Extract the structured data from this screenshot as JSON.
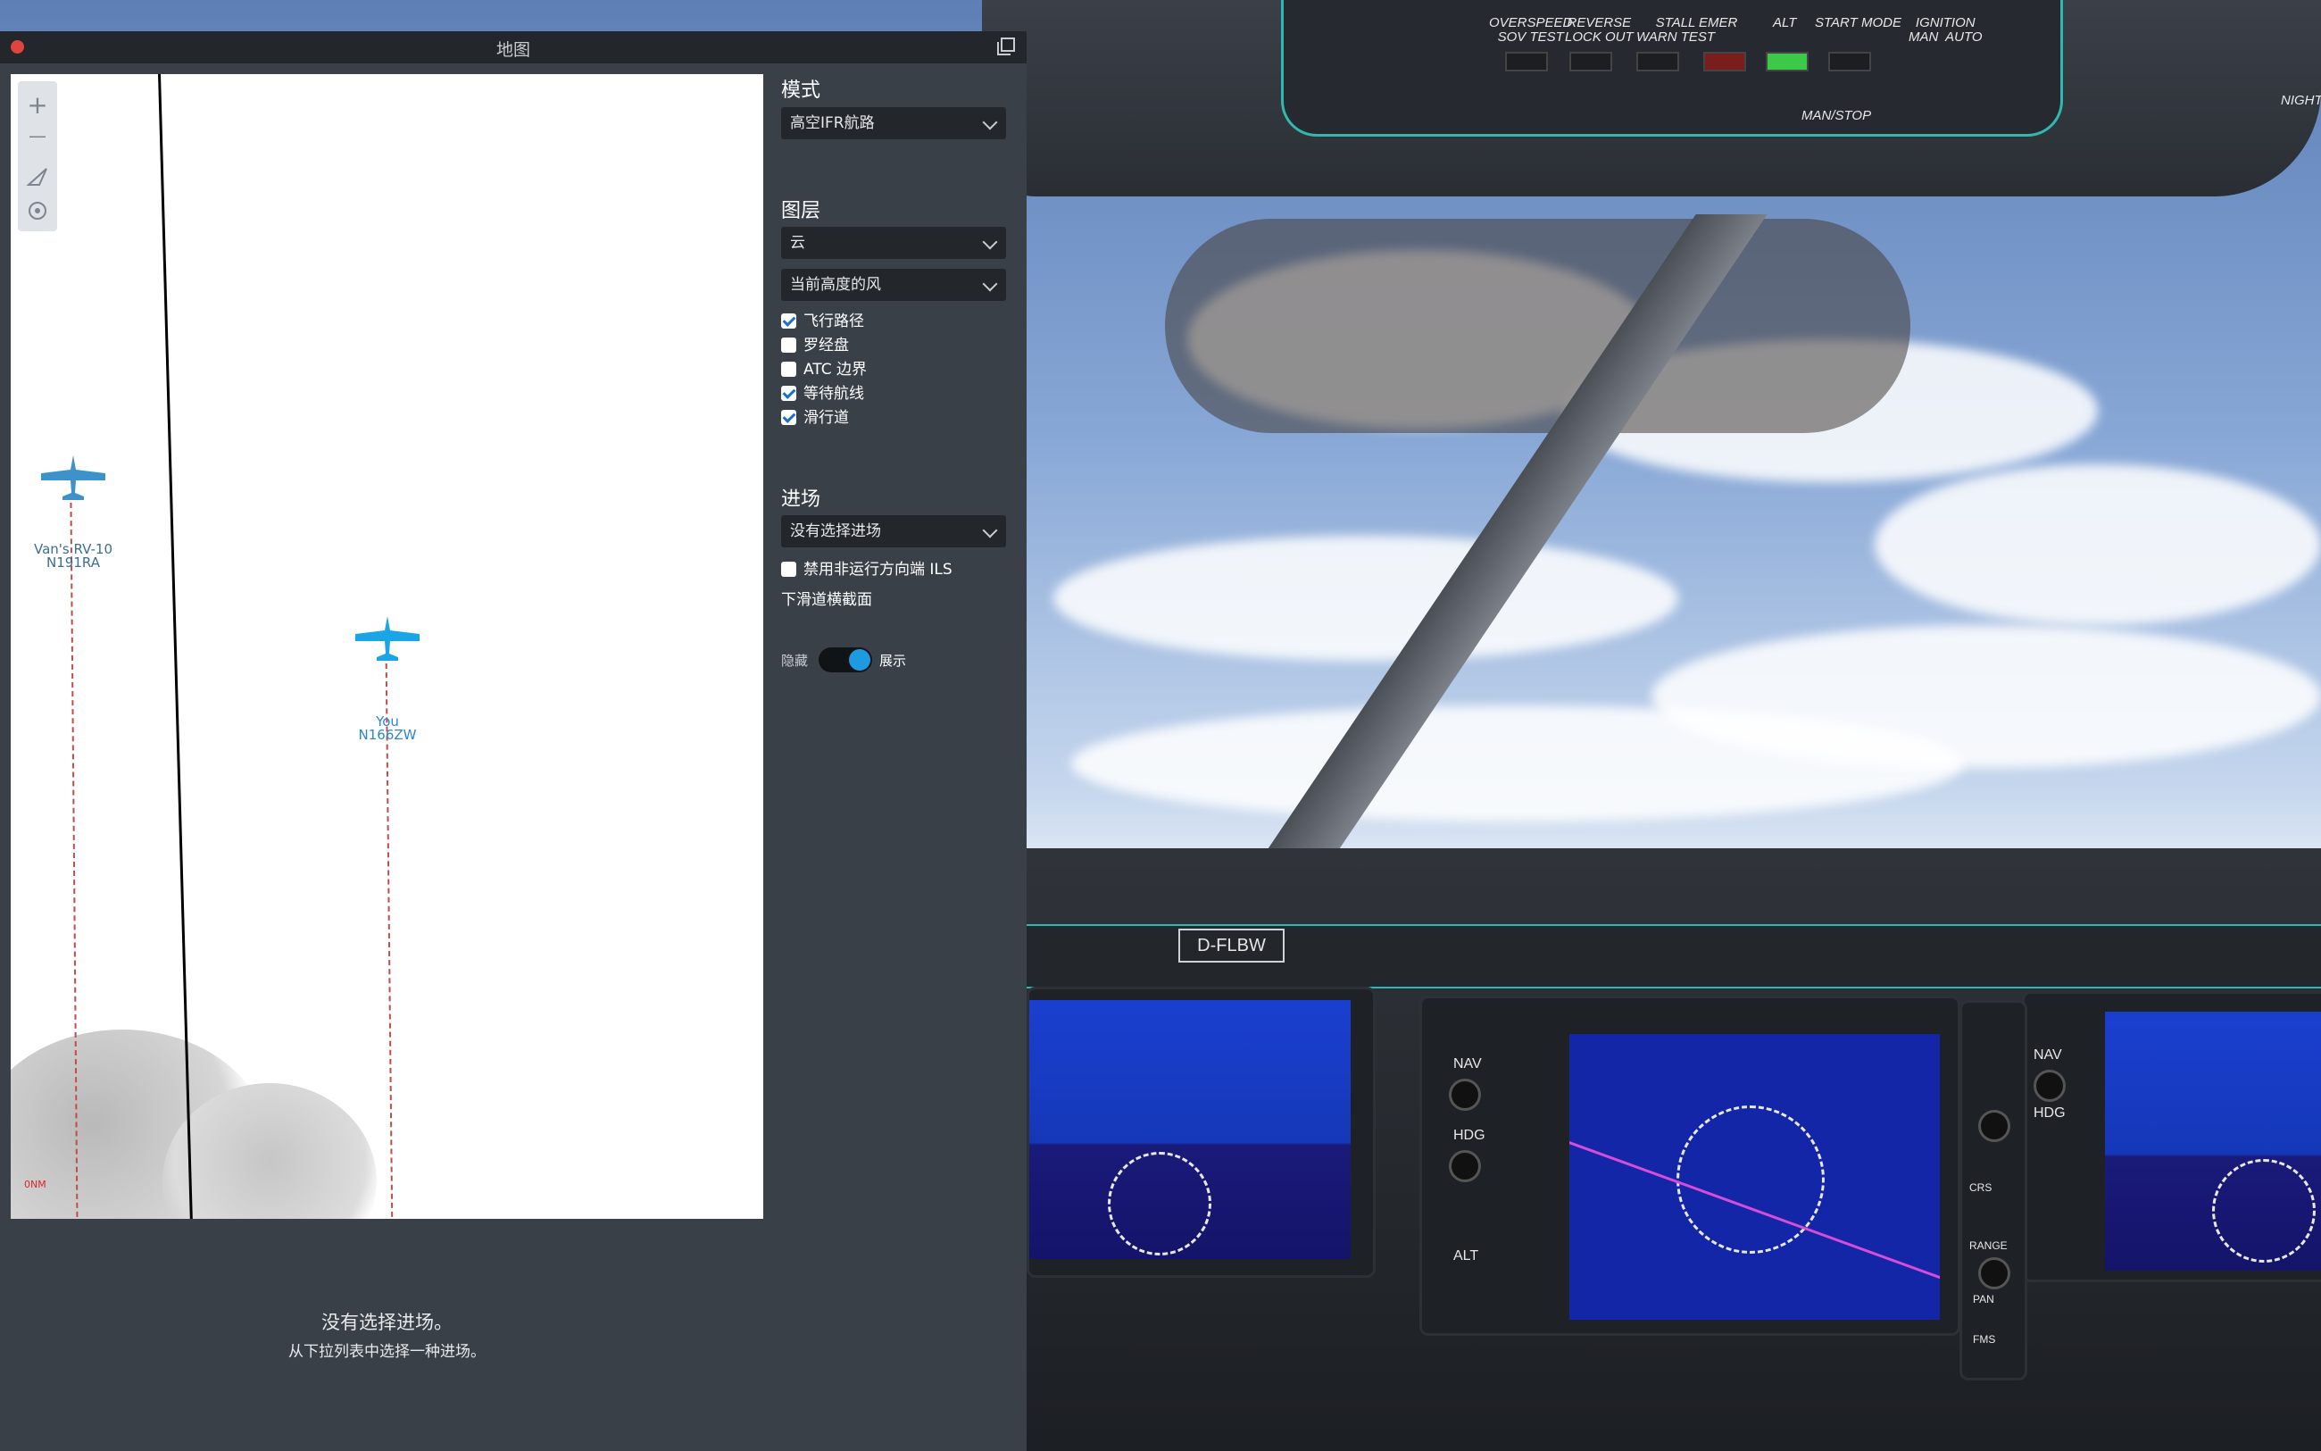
{
  "window": {
    "title": "地图"
  },
  "map": {
    "tools": [
      "+",
      "—"
    ],
    "aircraft": [
      {
        "type": "Van's RV-10",
        "reg": "N191RA"
      },
      {
        "type": "You",
        "reg": "N166ZW"
      }
    ],
    "corner_mark": "0NM"
  },
  "panel": {
    "mode": {
      "title": "模式",
      "selected": "高空IFR航路"
    },
    "layers": {
      "title": "图层",
      "dropdown1": "云",
      "dropdown2": "当前高度的风",
      "checks": [
        {
          "label": "飞行路径",
          "checked": true
        },
        {
          "label": "罗经盘",
          "checked": false
        },
        {
          "label": "ATC 边界",
          "checked": false
        },
        {
          "label": "等待航线",
          "checked": true
        },
        {
          "label": "滑行道",
          "checked": true
        }
      ]
    },
    "approach": {
      "title": "进场",
      "selected": "没有选择进场",
      "check_ils": "禁用非运行方向端 ILS",
      "glide_title": "下滑道横截面",
      "toggle_off": "隐藏",
      "toggle_on": "展示",
      "toggle_state": true
    }
  },
  "empty": {
    "line1": "没有选择进场。",
    "line2": "从下拉列表中选择一种进场。"
  },
  "cockpit": {
    "overhead_labels": [
      "OVERSPEED\nSOV TEST",
      "REVERSE\nLOCK OUT",
      "STALL\nWARN TEST",
      "EMER",
      "ALT",
      "START MODE",
      "IGNITION\nMAN  AUTO",
      "MAN/STOP",
      "NIGHT"
    ],
    "tail_number": "D-FLBW",
    "mfd_labels": [
      "NAV",
      "HDG",
      "ALT",
      "FMS",
      "CRS",
      "RANGE",
      "PAN"
    ]
  },
  "colors": {
    "panel_bg": "#3a4048",
    "titlebar": "#23272c",
    "accent": "#1e9be0",
    "teal_trim": "#2fb8b0",
    "route": "#c24b4b",
    "plane_other": "#3d92c9",
    "plane_you": "#1aa6e6"
  }
}
